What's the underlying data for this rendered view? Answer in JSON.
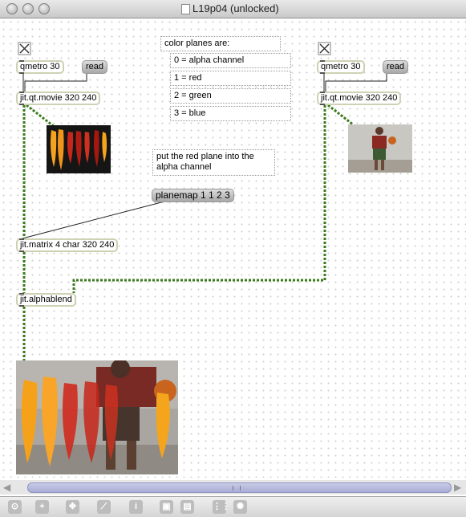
{
  "window": {
    "title": "L19p04 (unlocked)"
  },
  "patch": {
    "left_chain": {
      "metro": "qmetro 30",
      "read": "read",
      "movie": "jit.qt.movie 320 240"
    },
    "right_chain": {
      "metro": "qmetro 30",
      "read": "read",
      "movie": "jit.qt.movie 320 240"
    },
    "comments": {
      "color_planes_header": "color planes are:",
      "plane_0": "0 = alpha channel",
      "plane_1": "1 = red",
      "plane_2": "2 = green",
      "plane_3": "3 = blue",
      "planemap_note": "put the red plane into the alpha channel"
    },
    "planemap_message": "planemap 1 1 2 3",
    "matrix": "jit.matrix 4 char 320 240",
    "alphablend": "jit.alphablend"
  },
  "toolbar": {
    "icons": [
      "lock-icon",
      "new-object-icon",
      "move-icon",
      "presentation-icon",
      "inspector-icon",
      "grid-icon",
      "grid-snap-icon",
      "align-icon",
      "settings-icon"
    ],
    "accent": "#bdbdbd"
  },
  "colors": {
    "patch_cord": "#3a7a1a",
    "scrollbar_thumb": "#a9acd6"
  }
}
